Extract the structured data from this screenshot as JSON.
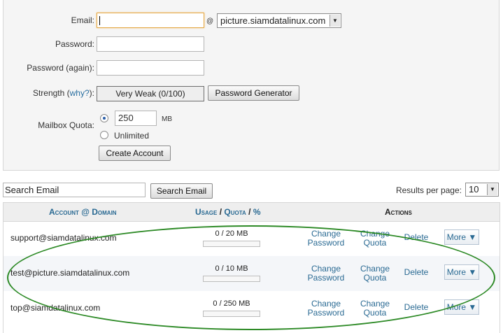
{
  "form": {
    "email_label": "Email:",
    "email_value": "",
    "at_symbol": "@",
    "domain_selected": "picture.siamdatalinux.com",
    "password_label": "Password:",
    "password_again_label": "Password (again):",
    "strength_label": "Strength (",
    "strength_why": "why?",
    "strength_close": "):",
    "strength_value": "Very Weak (0/100)",
    "password_generator_button": "Password Generator",
    "quota_label": "Mailbox Quota:",
    "quota_value": "250",
    "quota_unit": "MB",
    "unlimited_label": "Unlimited",
    "create_button": "Create Account"
  },
  "search": {
    "placeholder": "Search Email",
    "button": "Search Email",
    "results_label": "Results per page:",
    "results_value": "10"
  },
  "table": {
    "headers": {
      "account": "Account @ Domain",
      "usage": "Usage",
      "sep1": "/",
      "quota": "Quota",
      "sep2": "/",
      "percent": "%",
      "actions": "Actions"
    },
    "rows": [
      {
        "email": "support@siamdatalinux.com",
        "usage": "0 / 20 MB",
        "fill": 0
      },
      {
        "email": "test@picture.siamdatalinux.com",
        "usage": "0 / 10 MB",
        "fill": 0
      },
      {
        "email": "top@siamdatalinux.com",
        "usage": "0 / 250 MB",
        "fill": 0
      }
    ],
    "actions": {
      "change_password_1": "Change",
      "change_password_2": "Password",
      "change_quota_1": "Change",
      "change_quota_2": "Quota",
      "delete": "Delete",
      "more": "More ▼"
    }
  },
  "colors": {
    "link": "#2a6a93",
    "annotation": "#2d8a26"
  }
}
